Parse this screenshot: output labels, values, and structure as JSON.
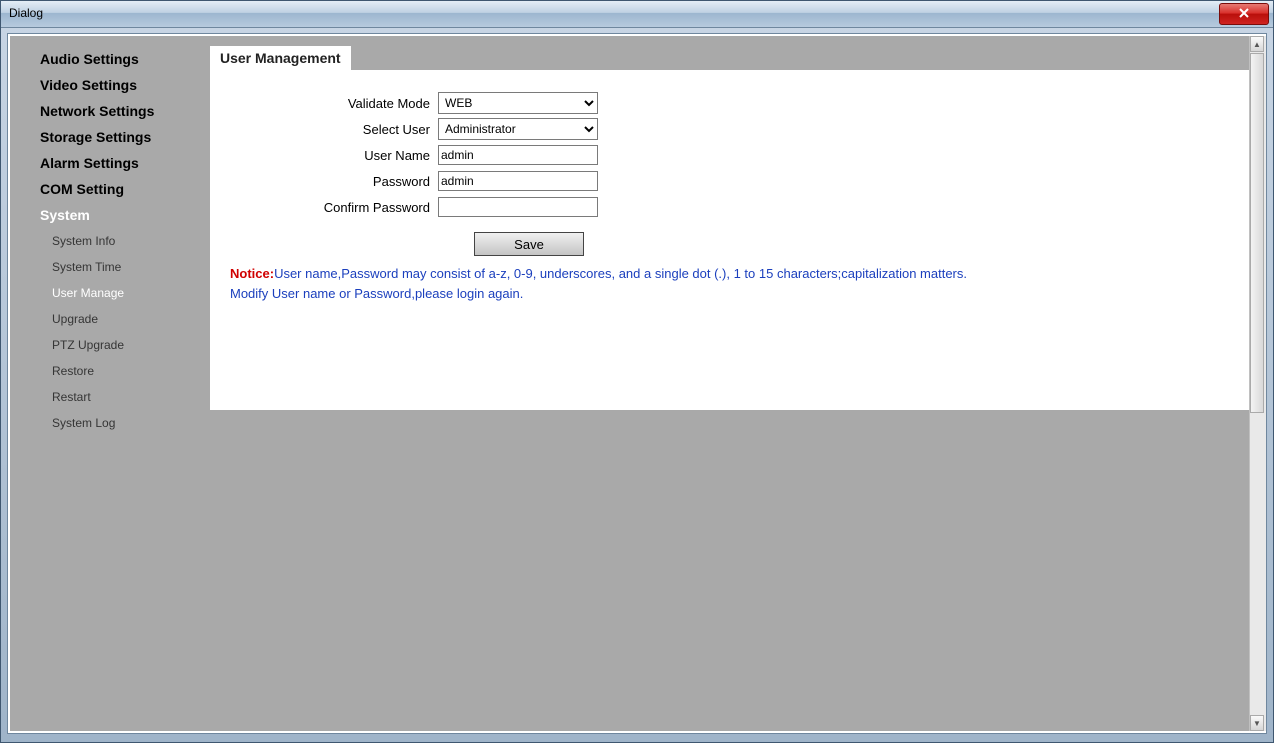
{
  "window": {
    "title": "Dialog"
  },
  "sidebar": {
    "items": [
      {
        "label": "Audio Settings"
      },
      {
        "label": "Video Settings"
      },
      {
        "label": "Network Settings"
      },
      {
        "label": "Storage Settings"
      },
      {
        "label": "Alarm Settings"
      },
      {
        "label": "COM Setting"
      },
      {
        "label": "System",
        "active": true
      }
    ],
    "sub": [
      {
        "label": "System Info"
      },
      {
        "label": "System Time"
      },
      {
        "label": "User Manage",
        "active": true
      },
      {
        "label": "Upgrade"
      },
      {
        "label": "PTZ Upgrade"
      },
      {
        "label": "Restore"
      },
      {
        "label": "Restart"
      },
      {
        "label": "System Log"
      }
    ]
  },
  "main": {
    "tab": "User Management",
    "form": {
      "validate_mode_label": "Validate Mode",
      "validate_mode_value": "WEB",
      "select_user_label": "Select User",
      "select_user_value": "Administrator",
      "user_name_label": "User Name",
      "user_name_value": "admin",
      "password_label": "Password",
      "password_value": "admin",
      "confirm_password_label": "Confirm Password",
      "confirm_password_value": "",
      "save_label": "Save"
    },
    "notice": {
      "label": "Notice:",
      "line1": "User name,Password may consist of a-z, 0-9, underscores, and a single dot (.), 1 to 15 characters;capitalization matters.",
      "line2": "Modify User name or Password,please login again."
    }
  }
}
